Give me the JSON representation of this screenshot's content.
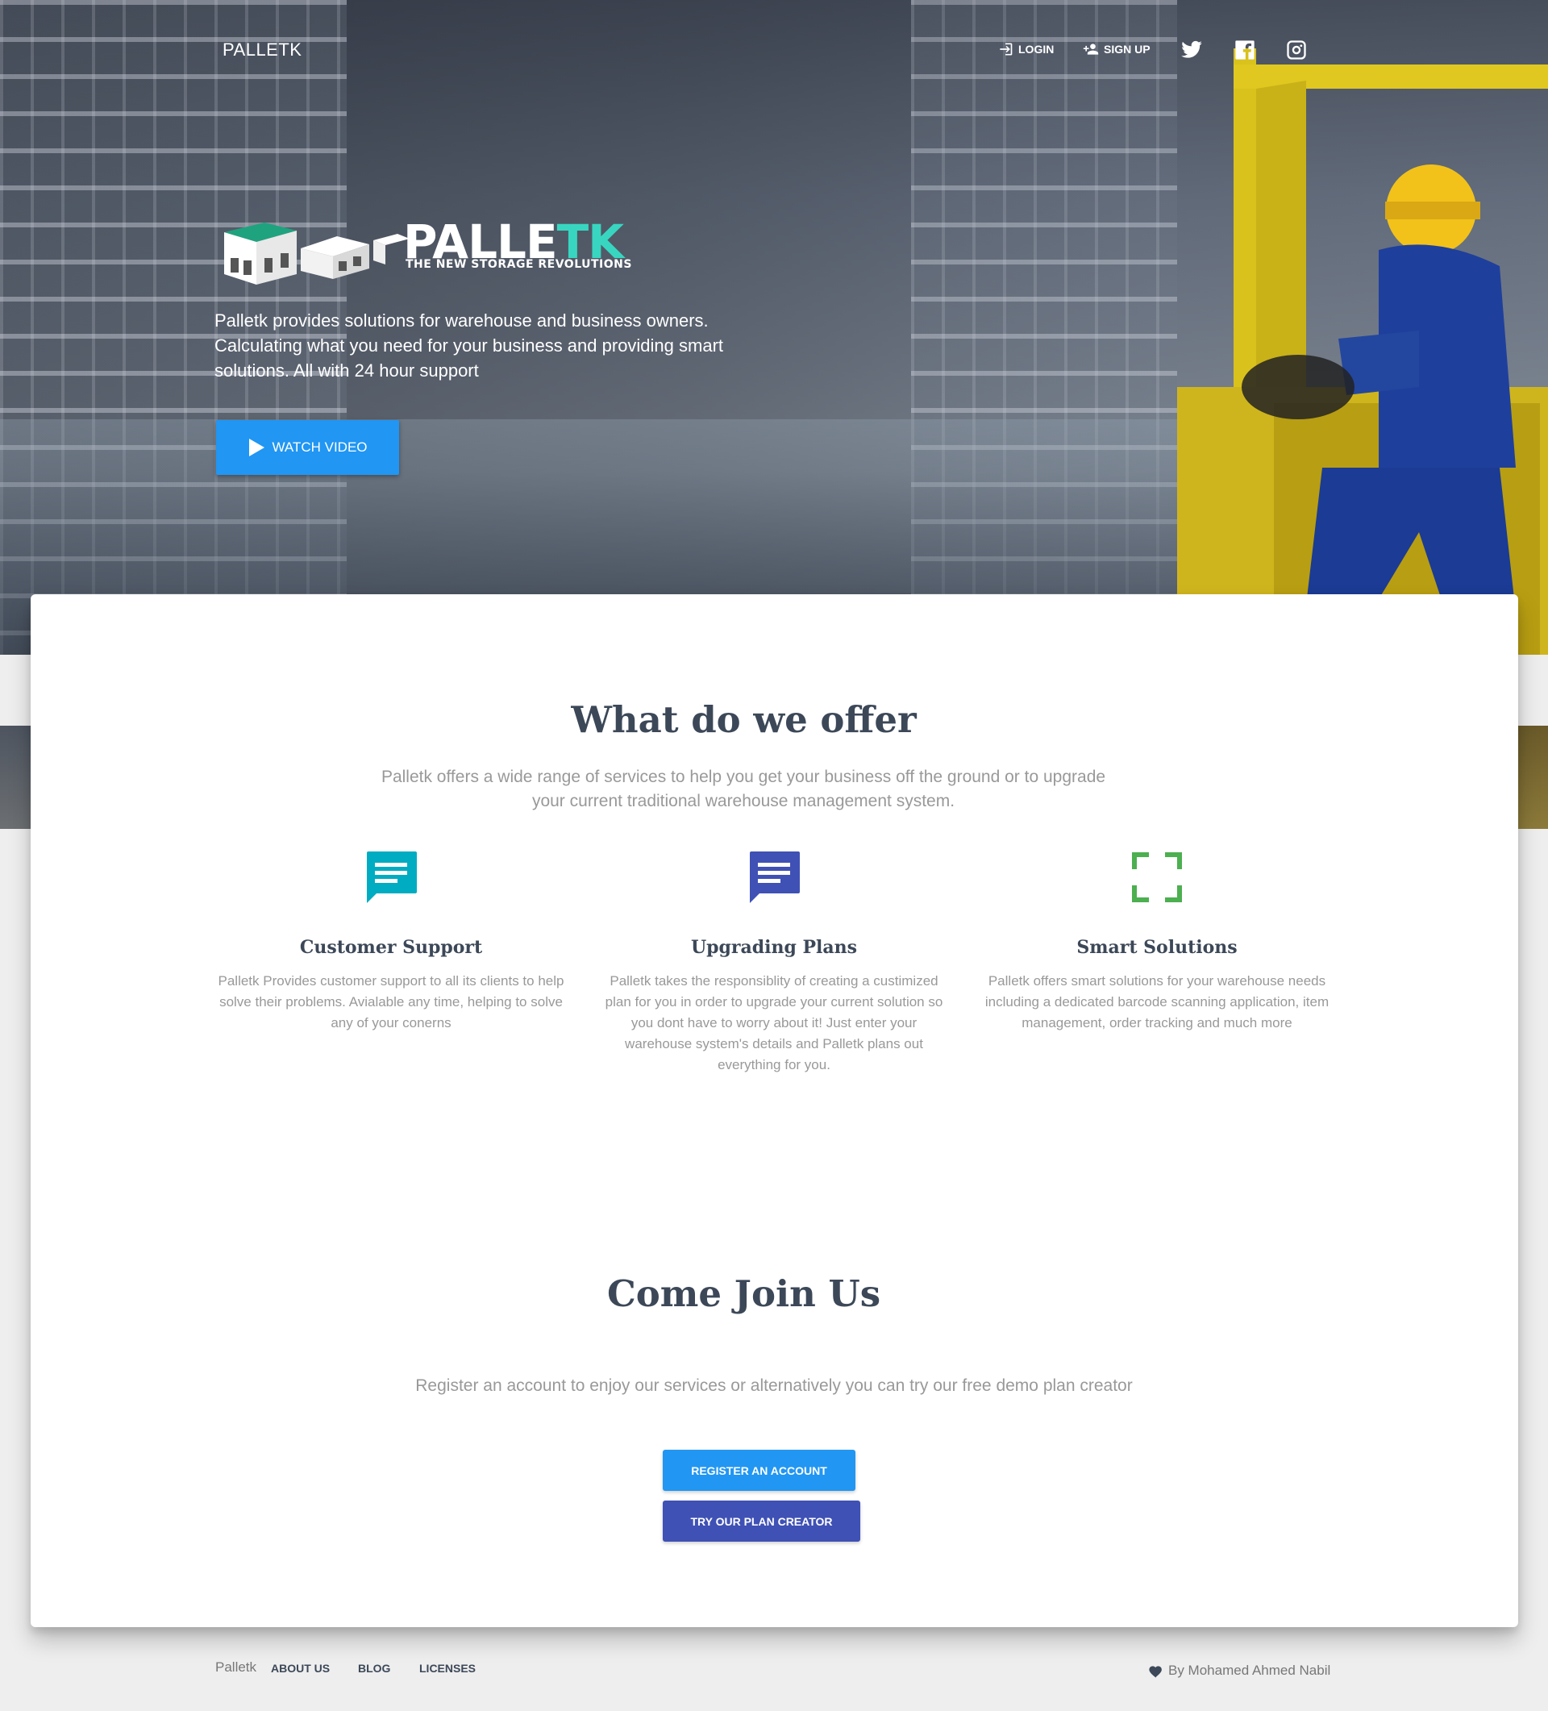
{
  "header": {
    "brand": "PALLETK",
    "login_label": "LOGIN",
    "signup_label": "SIGN UP",
    "social": [
      "twitter-icon",
      "facebook-icon",
      "instagram-icon"
    ]
  },
  "hero": {
    "logo_word_main": "PALLE",
    "logo_word_accent": "TK",
    "logo_tagline": "THE NEW STORAGE REVOLUTIONS",
    "text": "Palletk provides solutions for warehouse and business owners. Calculating what you need for your business and providing smart solutions. All with 24 hour support",
    "watch_label": "WATCH VIDEO"
  },
  "offer": {
    "title": "What do we offer",
    "description": "Palletk offers a wide range of services to help you get your business off the ground or to upgrade your current traditional warehouse management system.",
    "features": [
      {
        "icon": "chat-icon",
        "color": "#00acc1",
        "title": "Customer Support",
        "text": "Palletk Provides customer support to all its clients to help solve their problems. Avialable any time, helping to solve any of your conerns"
      },
      {
        "icon": "chat-icon",
        "color": "#3f51b5",
        "title": "Upgrading Plans",
        "text": "Palletk takes the responsiblity of creating a custimized plan for you in order to upgrade your current solution so you dont have to worry about it! Just enter your warehouse system's details and Palletk plans out everything for you."
      },
      {
        "icon": "scan-frame-icon",
        "color": "#4caf50",
        "title": "Smart Solutions",
        "text": "Palletk offers smart solutions for your warehouse needs including a dedicated barcode scanning application, item management, order tracking and much more"
      }
    ]
  },
  "join": {
    "title": "Come Join Us",
    "description": "Register an account to enjoy our services or alternatively you can try our free demo plan creator",
    "register_label": "REGISTER AN ACCOUNT",
    "plan_label": "TRY OUR PLAN CREATOR"
  },
  "footer": {
    "brand": "Palletk",
    "links": [
      "ABOUT US",
      "BLOG",
      "LICENSES"
    ],
    "credit": "By Mohamed Ahmed Nabil"
  },
  "colors": {
    "primary": "#2196f3",
    "indigo": "#3f51b5",
    "teal_accent": "#38d6c0",
    "heading": "#3c4858",
    "muted": "#999999"
  }
}
